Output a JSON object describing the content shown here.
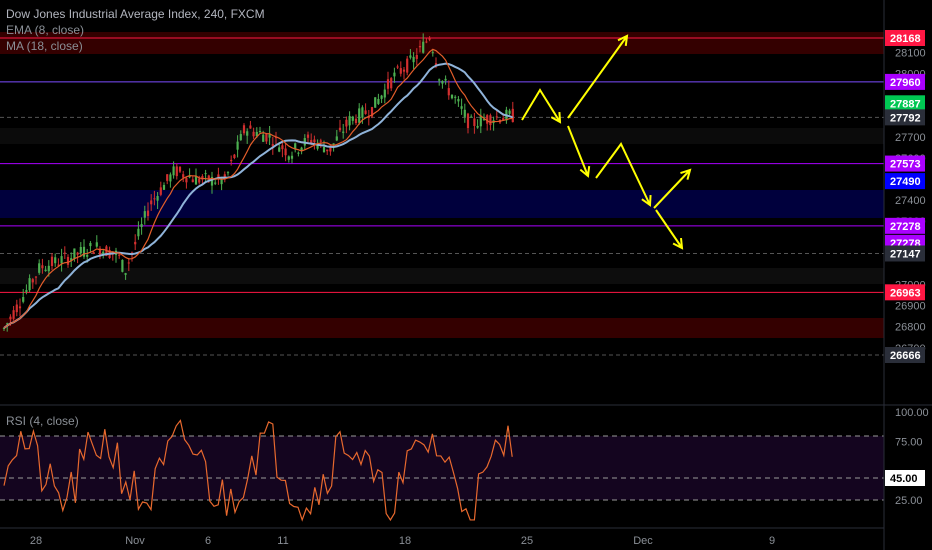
{
  "header": {
    "title": "Dow Jones Industrial Average Index, 240, FXCM",
    "ema": "EMA (8, close)",
    "ma": "MA (18, close)"
  },
  "rsi": {
    "label": "RSI (4, close)",
    "levels": [
      "100.00",
      "75.00",
      "25.00"
    ],
    "value_tag": "45.00"
  },
  "price_axis": {
    "ticks": [
      {
        "label": "28100",
        "value": 28100
      },
      {
        "label": "28000",
        "value": 28000
      },
      {
        "label": "27700",
        "value": 27700
      },
      {
        "label": "27600",
        "value": 27600
      },
      {
        "label": "27400",
        "value": 27400
      },
      {
        "label": "27300",
        "value": 27300
      },
      {
        "label": "27000",
        "value": 27000
      },
      {
        "label": "26900",
        "value": 26900
      },
      {
        "label": "26800",
        "value": 26800
      },
      {
        "label": "26700",
        "value": 26700
      }
    ]
  },
  "price_tags": [
    {
      "label": "28168",
      "value": 28168,
      "color": "#ff1744",
      "text": "#ffffff"
    },
    {
      "label": "27960",
      "value": 27960,
      "color": "#aa00ff",
      "text": "#ffffff"
    },
    {
      "label": "27887",
      "value": 27887,
      "color": "#00c853",
      "text": "#ffffff"
    },
    {
      "label": "27792",
      "value": 27792,
      "color": "#2a2e39",
      "text": "#ffffff"
    },
    {
      "label": "27573",
      "value": 27573,
      "color": "#aa00ff",
      "text": "#ffffff"
    },
    {
      "label": "27490",
      "value": 27490,
      "color": "#0000ff",
      "text": "#ffffff"
    },
    {
      "label": "27278",
      "value": 27278,
      "color": "#aa00ff",
      "text": "#ffffff"
    },
    {
      "label": "27278",
      "value": 27278,
      "color": "#aa00ff",
      "text": "#ffffff",
      "stacked": true
    },
    {
      "label": "27147",
      "value": 27147,
      "color": "#2a2e39",
      "text": "#ffffff"
    },
    {
      "label": "26963",
      "value": 26963,
      "color": "#ff1744",
      "text": "#ffffff"
    },
    {
      "label": "26666",
      "value": 26666,
      "color": "#2a2e39",
      "text": "#ffffff"
    }
  ],
  "time_axis": [
    "28",
    "Nov",
    "6",
    "11",
    "18",
    "25",
    "Dec",
    "9"
  ],
  "colors": {
    "bull": "#4caf50",
    "bear": "#d32f2f",
    "ema": "#e35d2a",
    "ma": "#8fb3d9",
    "arrows": "#ffff00",
    "rsi_line": "#e8692e"
  }
}
